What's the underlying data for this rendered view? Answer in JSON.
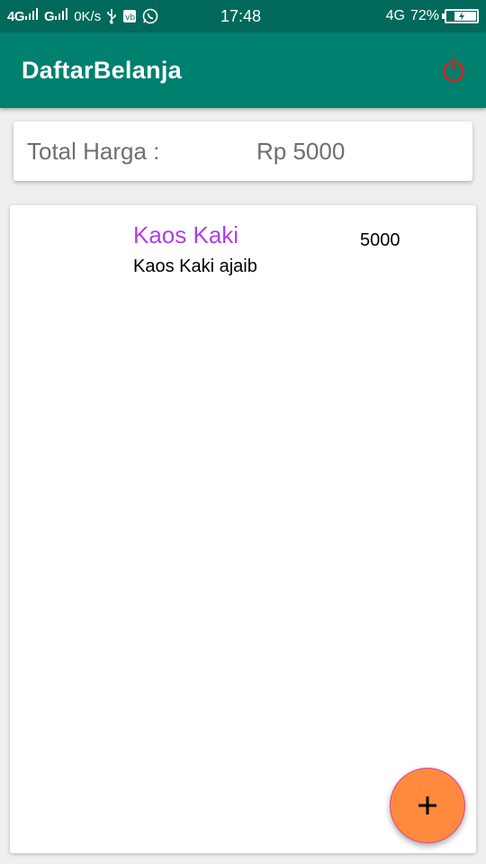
{
  "status_bar": {
    "signal_1": "4Gᴵᴵᴵᴵ",
    "signal_label_1": "4G",
    "signal_label_2": "G",
    "speed": "0K/s",
    "time": "17:48",
    "network_right": "4G",
    "battery_percent": "72%",
    "battery_level": 0.72,
    "icons": [
      "signal-icon",
      "usb-icon",
      "sim-icon",
      "whatsapp-icon",
      "battery-icon"
    ]
  },
  "app_bar": {
    "title": "DaftarBelanja",
    "power_icon": "power-icon",
    "power_color": "#c62828"
  },
  "total": {
    "label": "Total Harga :",
    "value": "Rp 5000"
  },
  "items": [
    {
      "name": "Kaos Kaki",
      "description": "Kaos Kaki ajaib",
      "price": "5000"
    }
  ],
  "fab": {
    "icon": "plus-icon",
    "color": "#ff8a3d"
  },
  "colors": {
    "primary": "#00806f",
    "primary_dark": "#00695c",
    "item_name": "#b03fe8"
  }
}
